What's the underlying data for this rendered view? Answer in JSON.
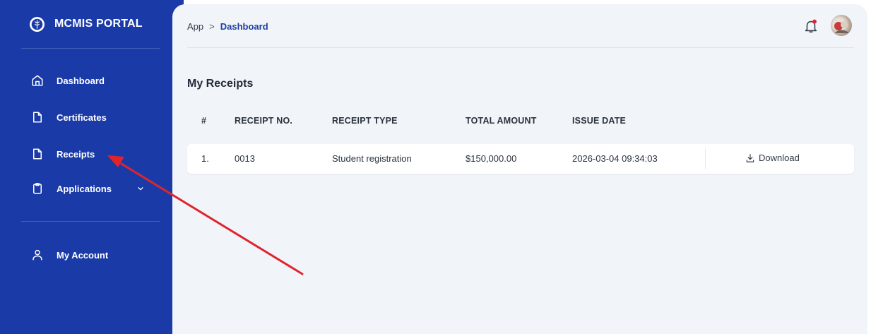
{
  "sidebar": {
    "brand": "MCMIS PORTAL",
    "items": [
      {
        "label": "Dashboard",
        "icon": "home-icon"
      },
      {
        "label": "Certificates",
        "icon": "file-icon"
      },
      {
        "label": "Receipts",
        "icon": "file-icon"
      },
      {
        "label": "Applications",
        "icon": "clipboard-icon",
        "has_chevron": true
      }
    ],
    "account": {
      "label": "My Account",
      "icon": "user-icon"
    }
  },
  "header": {
    "breadcrumb": {
      "root": "App",
      "separator": ">",
      "current": "Dashboard"
    },
    "notification_dot_color": "#e0242c"
  },
  "main": {
    "title": "My Receipts",
    "table": {
      "columns": [
        "#",
        "RECEIPT NO.",
        "RECEIPT TYPE",
        "TOTAL AMOUNT",
        "ISSUE DATE"
      ],
      "rows": [
        {
          "index": "1.",
          "receipt_no": "0013",
          "receipt_type": "Student registration",
          "total_amount": "$150,000.00",
          "issue_date": "2026-03-04 09:34:03",
          "action_label": "Download"
        }
      ]
    }
  },
  "colors": {
    "sidebar_bg": "#1a3aa8",
    "main_bg": "#f1f4f8",
    "accent": "#1f3ea5",
    "annotation_arrow": "#e0242c"
  }
}
